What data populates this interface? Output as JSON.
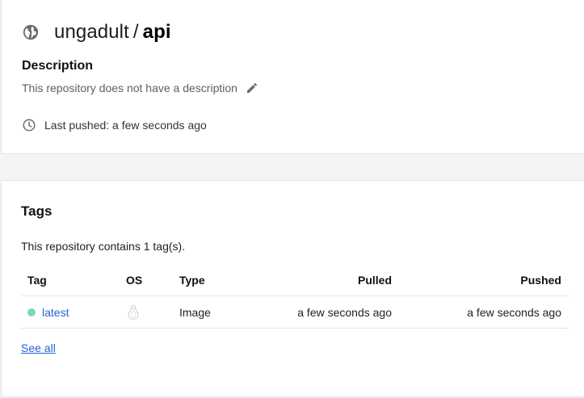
{
  "repo": {
    "owner": "ungadult",
    "separator": "/",
    "name": "api",
    "description_heading": "Description",
    "description_text": "This repository does not have a description",
    "last_pushed": "Last pushed: a few seconds ago",
    "visibility_icon": "globe-icon",
    "edit_icon": "pencil-icon",
    "time_icon": "clock-icon"
  },
  "tags": {
    "heading": "Tags",
    "count_text": "This repository contains 1 tag(s).",
    "columns": [
      "Tag",
      "OS",
      "Type",
      "Pulled",
      "Pushed"
    ],
    "rows": [
      {
        "tag": "latest",
        "os_icon": "linux-icon",
        "type": "Image",
        "pulled": "a few seconds ago",
        "pushed": "a few seconds ago",
        "status_color": "#7fd7b5"
      }
    ],
    "see_all": "See all"
  },
  "colors": {
    "link": "#1e63d6",
    "background": "#f4f4f6",
    "card": "#ffffff"
  }
}
